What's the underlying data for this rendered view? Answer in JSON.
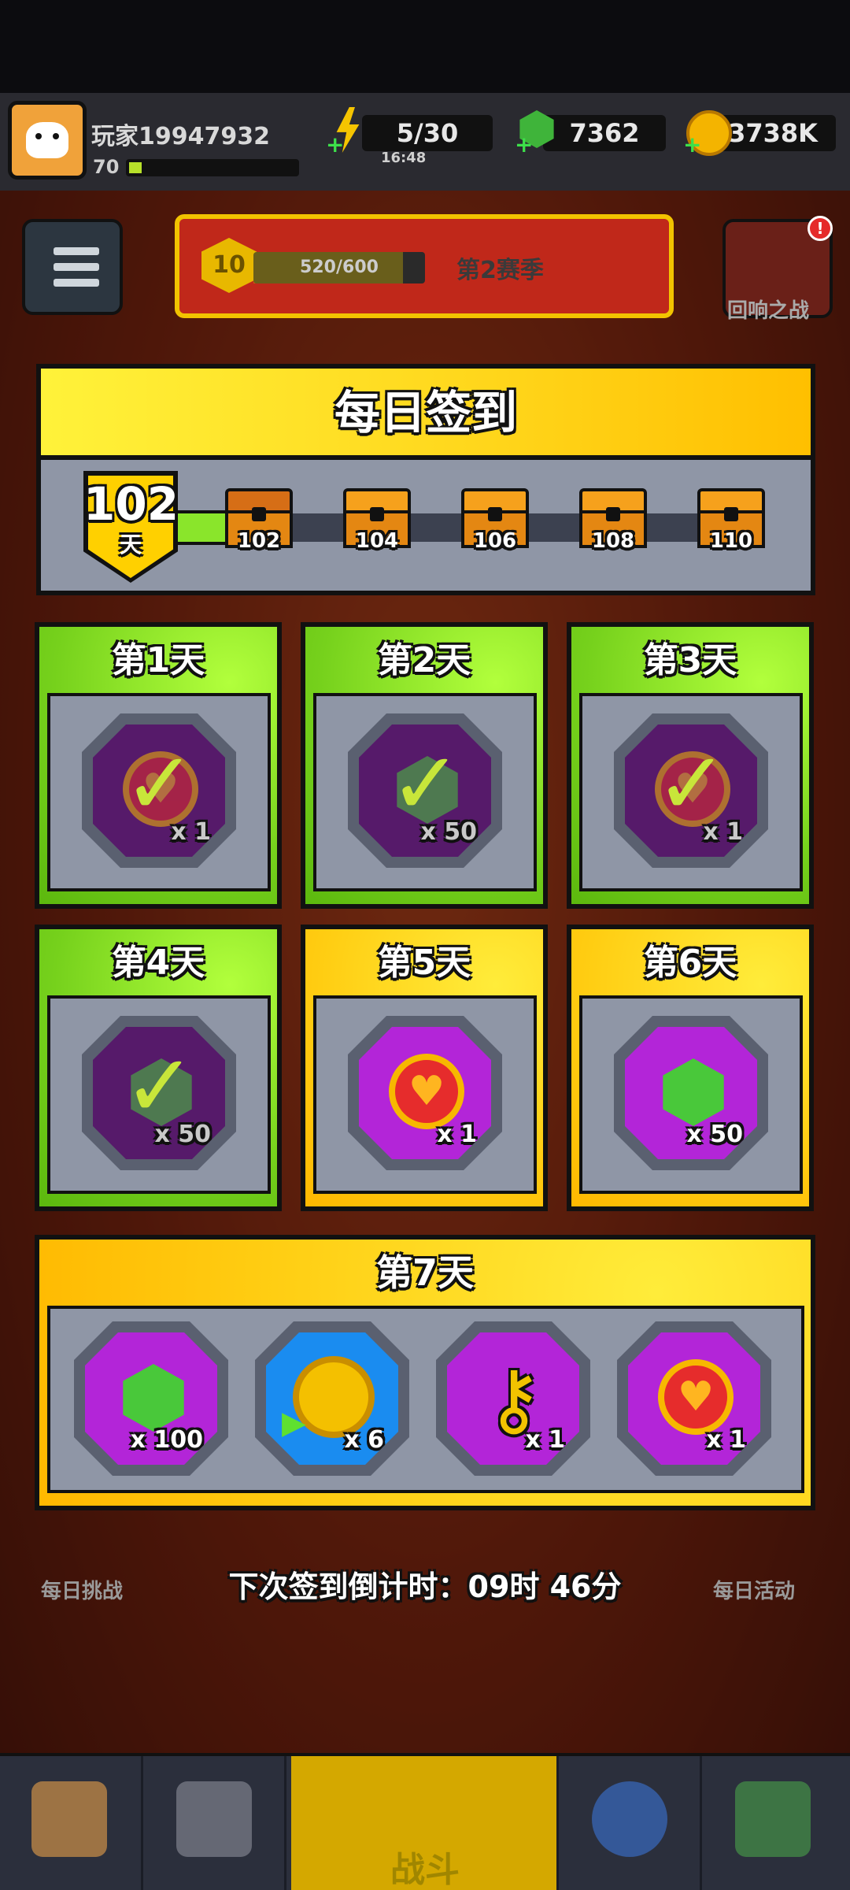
{
  "player": {
    "name": "玩家19947932",
    "level": "70"
  },
  "resources": {
    "energy": "5/30",
    "energy_timer": "16:48",
    "gems": "7362",
    "coins": "3738K"
  },
  "season": {
    "level": "10",
    "progress_text": "520/600",
    "progress": 0.8667,
    "name": "第2赛季"
  },
  "echo_battle": {
    "label": "回响之战",
    "badge": "!"
  },
  "modal": {
    "title": "每日签到",
    "streak": {
      "count": "102",
      "unit": "天"
    },
    "milestones": [
      "102",
      "104",
      "106",
      "108",
      "110"
    ]
  },
  "days": [
    {
      "title": "第1天",
      "item": "heart-icon",
      "qty": "x 1",
      "claimed": true
    },
    {
      "title": "第2天",
      "item": "gem-icon",
      "qty": "x 50",
      "claimed": true
    },
    {
      "title": "第3天",
      "item": "heart-icon",
      "qty": "x 1",
      "claimed": true
    },
    {
      "title": "第4天",
      "item": "gem-icon",
      "qty": "x 50",
      "claimed": true
    },
    {
      "title": "第5天",
      "item": "heart-icon",
      "qty": "x 1",
      "claimed": false
    },
    {
      "title": "第6天",
      "item": "gem-icon",
      "qty": "x 50",
      "claimed": false
    }
  ],
  "day7": {
    "title": "第7天",
    "rewards": [
      {
        "item": "gem-icon",
        "qty": "x 100"
      },
      {
        "item": "coin-boost-icon",
        "qty": "x 6"
      },
      {
        "item": "key-icon",
        "qty": "x 1"
      },
      {
        "item": "heart-icon",
        "qty": "x 1"
      }
    ]
  },
  "countdown": "下次签到倒计时：09时 46分",
  "background_labels": {
    "daily_challenge": "每日挑战",
    "daily_activity": "每日活动",
    "battle_tab": "战斗"
  },
  "colors": {
    "claimed_card": "#76d11c",
    "pending_card": "#ffcd12",
    "item_slot": "#b325d8"
  }
}
